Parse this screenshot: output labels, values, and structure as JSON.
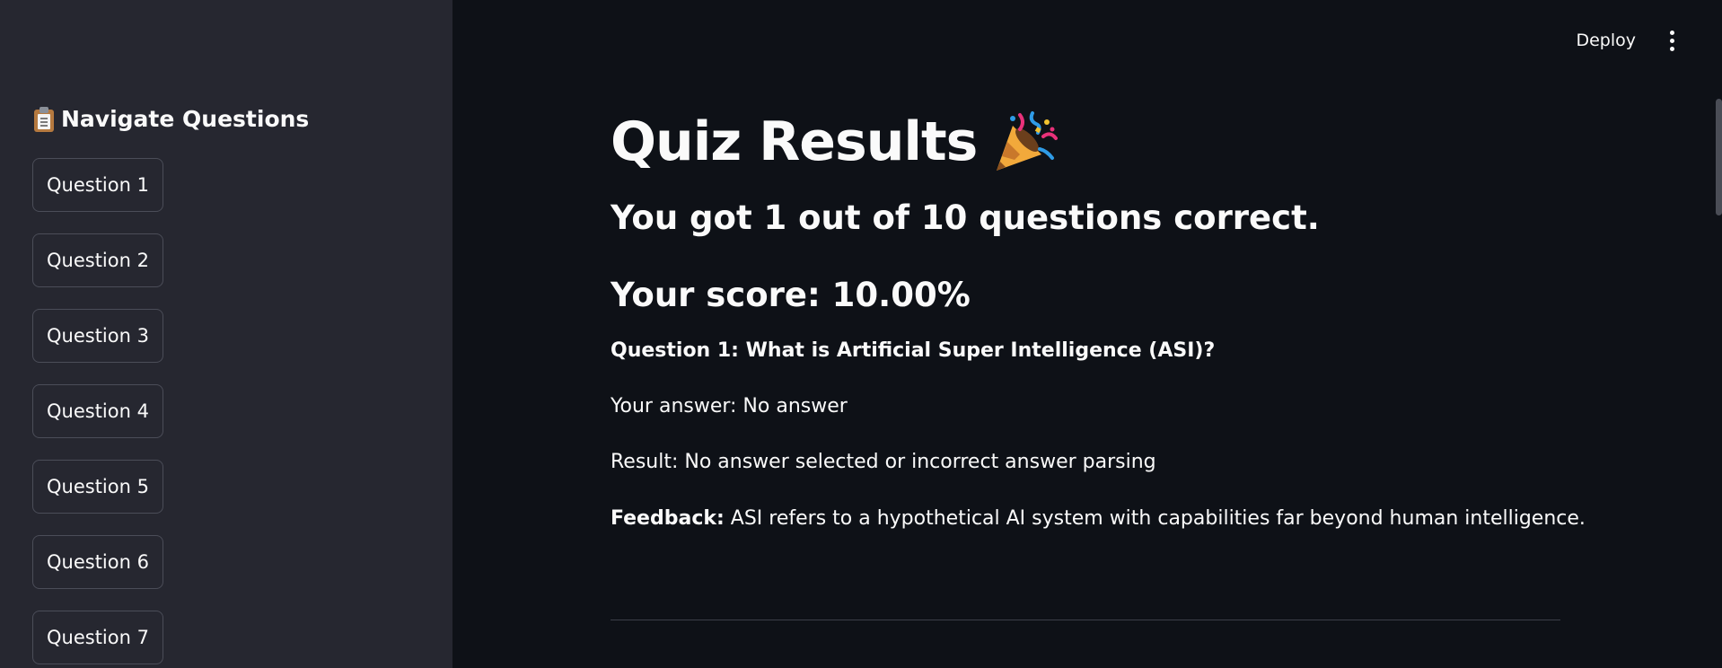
{
  "sidebar": {
    "heading_icon": "clipboard-icon",
    "heading": "Navigate Questions",
    "items": [
      {
        "label": "Question 1"
      },
      {
        "label": "Question 2"
      },
      {
        "label": "Question 3"
      },
      {
        "label": "Question 4"
      },
      {
        "label": "Question 5"
      },
      {
        "label": "Question 6"
      },
      {
        "label": "Question 7"
      }
    ]
  },
  "header": {
    "deploy_label": "Deploy",
    "menu_icon": "more-vertical-icon"
  },
  "main": {
    "title": "Quiz Results",
    "title_icon": "party-popper-icon",
    "correct_summary": "You got 1 out of 10 questions correct.",
    "score": "Your score: 10.00%",
    "question": {
      "title": "Question 1: What is Artificial Super Intelligence (ASI)?",
      "your_answer": "Your answer: No answer",
      "result": "Result: No answer selected or incorrect answer parsing",
      "feedback_label": "Feedback:",
      "feedback_text": " ASI refers to a hypothetical AI system with capabilities far beyond human intelligence."
    }
  },
  "colors": {
    "main_bg": "#0e1117",
    "sidebar_bg": "#262730",
    "text": "#fafafa",
    "button_border": "#4b4d58"
  }
}
